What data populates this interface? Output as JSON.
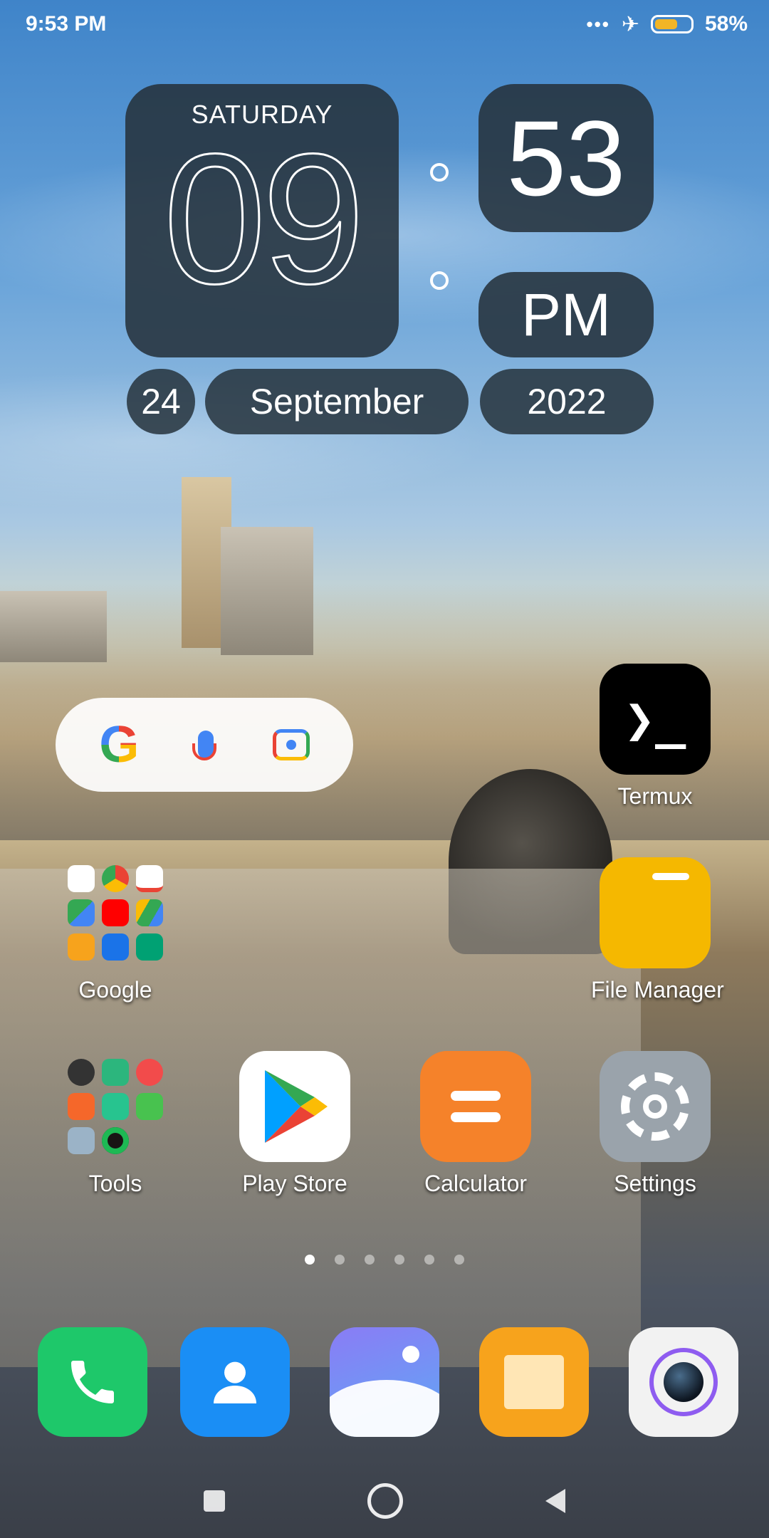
{
  "status_bar": {
    "time": "9:53 PM",
    "battery": "58%",
    "icons": [
      "more-dots-icon",
      "airplane-mode-icon",
      "battery-icon"
    ]
  },
  "clock_widget": {
    "weekday": "SATURDAY",
    "hour": "09",
    "minute": "53",
    "ampm": "PM",
    "day": "24",
    "month": "September",
    "year": "2022"
  },
  "search_widget": {
    "icons": [
      "google-g-icon",
      "voice-search-mic-icon",
      "google-lens-icon"
    ]
  },
  "apps": {
    "termux": {
      "label": "Termux",
      "glyph": "❯_"
    },
    "google_folder": {
      "label": "Google"
    },
    "file_manager": {
      "label": "File Manager"
    },
    "tools_folder": {
      "label": "Tools"
    },
    "play_store": {
      "label": "Play Store"
    },
    "calculator": {
      "label": "Calculator"
    },
    "settings": {
      "label": "Settings"
    }
  },
  "dock": [
    "phone-icon",
    "contacts-icon",
    "gallery-icon",
    "messages-icon",
    "camera-icon"
  ],
  "pages": {
    "count": 6,
    "active": 1
  },
  "colors": {
    "widget_bg": "#26323c",
    "termux": "#000000",
    "file_manager": "#f5b800",
    "calculator": "#f5822a",
    "settings": "#9aa3ab",
    "phone": "#1ec86a",
    "contacts": "#1a8ef5",
    "messages": "#f7a31c"
  }
}
